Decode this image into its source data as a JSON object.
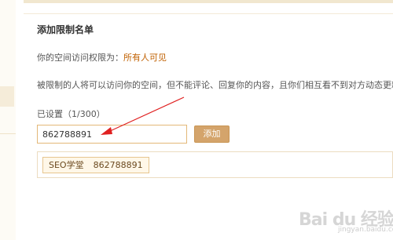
{
  "page": {
    "title": "添加限制名单",
    "access_label": "你的空间访问权限为：",
    "access_value": "所有人可见",
    "hint": "被限制的人将可以访问你的空间，但不能评论、回复你的内容，且你们相互看不到对方动态更新"
  },
  "count": {
    "label": "已设置（",
    "current": "1",
    "sep": "/",
    "max": "300",
    "close": "）"
  },
  "form": {
    "input_value": "862788891",
    "add_label": "添加"
  },
  "list": [
    {
      "name": "SEO学堂",
      "qq": "862788891"
    }
  ],
  "watermark": {
    "logo": "Bai du 经验",
    "url": "jingyan.baidu.com"
  },
  "colors": {
    "accent": "#c06000",
    "button": "#d4a46b",
    "input_border": "#e3b878",
    "annotation_arrow": "#e02020"
  }
}
